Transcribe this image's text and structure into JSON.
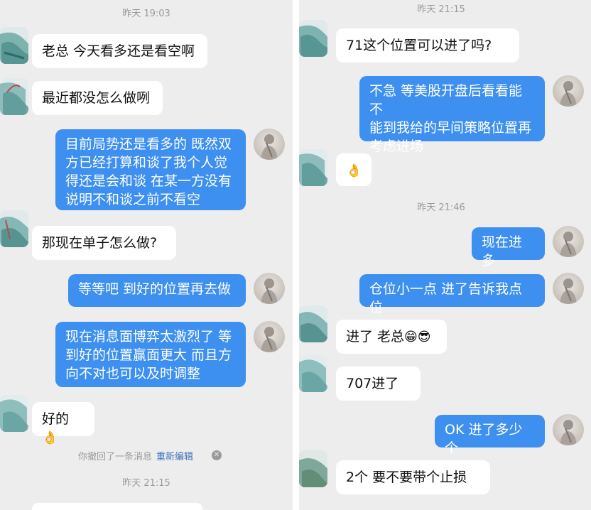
{
  "left": {
    "time_top": "昨天 19:03",
    "messages": [
      {
        "text": "老总 今天看多还是看空啊"
      },
      {
        "text": "最近都没怎么做咧"
      },
      {
        "text": "目前局势还是看多的 既然双\n方已经打算和谈了我个人觉\n得还是会和谈 在某一方没有\n说明不和谈之前不看空"
      },
      {
        "text": "那现在单子怎么做?"
      },
      {
        "text": "等等吧 到好的位置再去做"
      },
      {
        "text": "现在消息面博弈太激烈了 等\n到好的位置赢面更大 而且方\n向不对也可以及时调整"
      },
      {
        "text": "好的",
        "emoji": "👌"
      }
    ],
    "recall_text": "你撤回了一条消息",
    "recall_edit": "重新编辑",
    "time_bottom": "昨天 21:15"
  },
  "right": {
    "time_top": "昨天 21:15",
    "messages": [
      {
        "text": "71这个位置可以进了吗?"
      },
      {
        "text": "不急 等美股开盘后看看能不\n能到我给的早间策略位置再\n考虑进场"
      },
      {
        "emoji": "👌"
      },
      {
        "text": "现在进多"
      },
      {
        "text": "仓位小一点 进了告诉我点位"
      },
      {
        "text": "进了 老总",
        "emoji": "😁😎"
      },
      {
        "text": "707进了"
      },
      {
        "text": "OK 进了多少个"
      },
      {
        "text": "2个 要不要带个止损"
      }
    ],
    "time_mid": "昨天 21:46"
  },
  "colors": {
    "background": "#ededed",
    "outgoing_bubble": "#3d8ff0",
    "incoming_bubble": "#ffffff",
    "timestamp": "#9a9a9a",
    "link": "#3b73b9"
  },
  "icons": {
    "recall_close": "close-circle-icon",
    "incoming_avatar": "painted-avatar-icon",
    "outgoing_avatar": "portrait-avatar-icon"
  }
}
